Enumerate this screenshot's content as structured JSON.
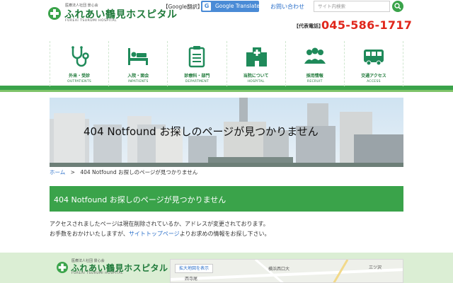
{
  "header": {
    "logo": {
      "corp": "医療法人社団 景心会",
      "name": "ふれあい鶴見ホスピタル",
      "name_en": "FUREAI TSURUMI HOSPITAL"
    },
    "google_label": "【Google翻訳】",
    "google_translate_label": "Google Translate",
    "contact_label": "お問い合わせ",
    "search_placeholder": "サイト内検索",
    "rep_label": "【代表電話】",
    "rep_phone": "045-586-1717"
  },
  "nav": {
    "items": [
      {
        "jp": "外来・受診",
        "en": "OUTPATIENTS",
        "icon": "stethoscope-icon"
      },
      {
        "jp": "入院・面会",
        "en": "INPATIENTS",
        "icon": "hospital-bed-icon"
      },
      {
        "jp": "診療科・部門",
        "en": "DEPARTMENT",
        "icon": "clipboard-icon"
      },
      {
        "jp": "当院について",
        "en": "HOSPITAL",
        "icon": "hospital-building-icon"
      },
      {
        "jp": "採用情報",
        "en": "RECRUIT",
        "icon": "people-icon"
      },
      {
        "jp": "交通アクセス",
        "en": "ACCESS",
        "icon": "bus-icon"
      }
    ]
  },
  "hero": {
    "title": "404 Notfound お探しのページが見つかりません"
  },
  "breadcrumb": {
    "home": "ホーム",
    "separator": ">",
    "current": "404 Notfound お探しのページが見つかりません"
  },
  "page": {
    "heading": "404 Notfound お探しのページが見つかりません",
    "line1": "アクセスされましたページは現在削除されているか、アドレスが変更されております。",
    "line2_before": "お手数をおかけいたしますが、",
    "line2_link": "サイトトップページ",
    "line2_after": "よりお求めの情報をお探し下さい。"
  },
  "footer": {
    "logo": {
      "corp": "医療法人社団 景心会",
      "name": "ふれあい鶴見ホスピタル",
      "name_en": "FUREAI TSURUMI HOSPITAL"
    },
    "map_button": "拡大地図を表示",
    "map_labels": [
      "横浜西口大",
      "西寺尾",
      "三ツ沢"
    ]
  },
  "colors": {
    "brand_green": "#3aa34a",
    "dark_green": "#1f7a3a",
    "phone_red": "#e0261b",
    "link_blue": "#2a6fc9"
  }
}
